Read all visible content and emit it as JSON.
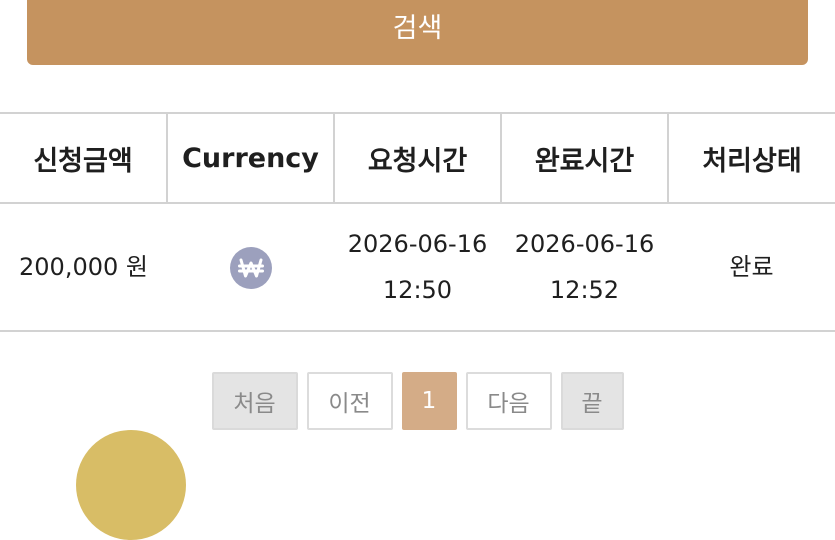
{
  "search": {
    "label": "검색"
  },
  "table": {
    "headers": [
      "신청금액",
      "Currency",
      "요청시간",
      "완료시간",
      "처리상태"
    ],
    "rows": [
      {
        "amount": "200,000 원",
        "currency_icon": "won-coin-icon",
        "request_date": "2026-06-16",
        "request_time": "12:50",
        "complete_date": "2026-06-16",
        "complete_time": "12:52",
        "status": "완료"
      }
    ]
  },
  "pagination": {
    "first": "처음",
    "prev": "이전",
    "current": "1",
    "next": "다음",
    "last": "끝"
  },
  "colors": {
    "accent": "#c5935f",
    "active_page": "#d4ac87",
    "status_done": "#4caf38",
    "coin": "#9ca0bd"
  }
}
